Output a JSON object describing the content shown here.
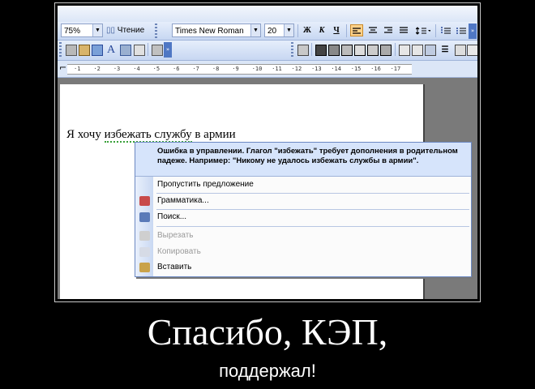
{
  "toolbar1": {
    "zoom": "75%",
    "reading_label": "Чтение",
    "font_name": "Times New Roman",
    "font_size": "20",
    "bold": "Ж",
    "italic": "К",
    "underline": "Ч",
    "overflow": "»"
  },
  "ruler": {
    "ticks": [
      "1",
      "2",
      "3",
      "4",
      "5",
      "6",
      "7",
      "8",
      "9",
      "10",
      "11",
      "12",
      "13",
      "14",
      "15",
      "16",
      "17"
    ]
  },
  "document": {
    "text_before": "Я хочу ",
    "flagged_text": "избежать службу",
    "text_after": " в армии"
  },
  "context_menu": {
    "message": "Ошибка в управлении. Глагол \"избежать\" требует дополнения в родительном падеже. Например: \"Никому не удалось избежать службы в армии\".",
    "items": [
      {
        "label": "Пропустить предложение",
        "enabled": true
      },
      {
        "label": "Грамматика...",
        "enabled": true
      },
      {
        "label": "Поиск...",
        "enabled": true
      },
      {
        "label": "Вырезать",
        "enabled": false
      },
      {
        "label": "Копировать",
        "enabled": false
      },
      {
        "label": "Вставить",
        "enabled": true
      }
    ]
  },
  "caption": {
    "title": "Спасибо, КЭП,",
    "subtitle": "поддержал!"
  }
}
